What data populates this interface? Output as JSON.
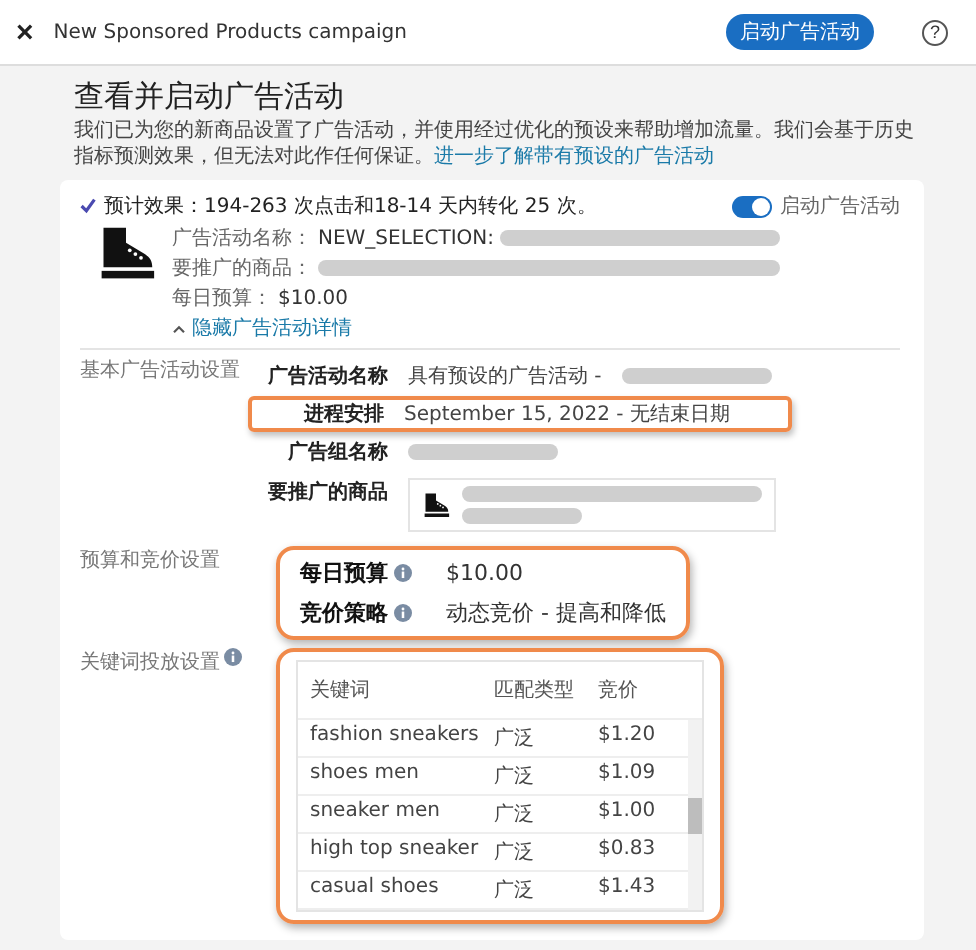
{
  "header": {
    "close": "×",
    "title": "New Sponsored Products campaign",
    "launch_button": "启动广告活动",
    "help": "?"
  },
  "page": {
    "title": "查看并启动广告活动",
    "description": "我们已为您的新商品设置了广告活动，并使用经过优化的预设来帮助增加流量。我们会基于历史指标预测效果，但无法对此作任何保证。",
    "link": "进一步了解带有预设的广告活动"
  },
  "summary": {
    "estimate": "预计效果：194-263 次点击和18-14 天内转化 25 次。",
    "toggle": {
      "label": "启动广告活动",
      "on": true
    },
    "details": [
      {
        "label": "广告活动名称：",
        "value": "NEW_SELECTION:",
        "redacted": true
      },
      {
        "label": "要推广的商品：",
        "redacted": true
      },
      {
        "label": "每日预算：",
        "value": "$10.00",
        "redacted": false
      }
    ],
    "collapse_link": "隐藏广告活动详情"
  },
  "basic_settings": {
    "section_label": "基本广告活动设置",
    "rows": [
      {
        "label": "广告活动名称",
        "value": "具有预设的广告活动 -",
        "redacted": true,
        "highlighted": false
      },
      {
        "label": "进程安排",
        "value": "September 15, 2022 - 无结束日期",
        "redacted": false,
        "highlighted": true
      },
      {
        "label": "广告组名称",
        "redacted": true,
        "highlighted": false
      },
      {
        "label": "要推广的商品",
        "kind": "product",
        "highlighted": false
      }
    ]
  },
  "budget_settings": {
    "section_label": "预算和竞价设置",
    "rows": [
      {
        "label": "每日预算",
        "value": "$10.00"
      },
      {
        "label": "竞价策略",
        "value": "动态竞价 - 提高和降低"
      }
    ]
  },
  "keyword_settings": {
    "section_label": "关键词投放设置",
    "table": {
      "columns": [
        "关键词",
        "匹配类型",
        "竞价"
      ],
      "rows": [
        [
          "fashion sneakers",
          "广泛",
          "$1.20"
        ],
        [
          "shoes men",
          "广泛",
          "$1.09"
        ],
        [
          "sneaker men",
          "广泛",
          "$1.00"
        ],
        [
          "high top sneaker",
          "广泛",
          "$0.83"
        ],
        [
          "casual shoes",
          "广泛",
          "$1.43"
        ]
      ]
    }
  }
}
